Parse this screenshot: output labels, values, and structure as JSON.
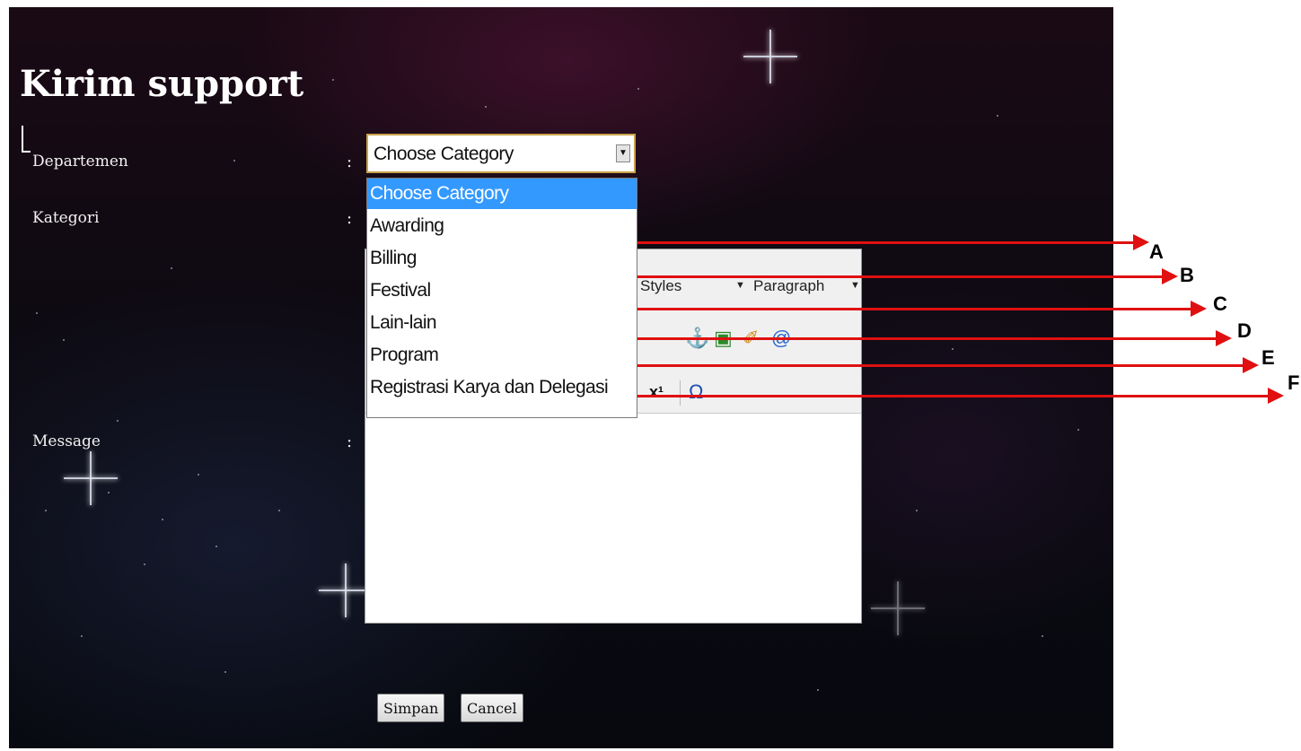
{
  "page": {
    "title": "Kirim support"
  },
  "form": {
    "departemen_label": "Departemen",
    "kategori_label": "Kategori",
    "message_label": "Message",
    "colon": ":"
  },
  "category_select": {
    "selected_value": "Choose Category",
    "options": [
      "Choose Category",
      "Awarding",
      "Billing",
      "Festival",
      "Lain-lain",
      "Program",
      "Registrasi Karya dan Delegasi"
    ]
  },
  "editor": {
    "styles_label": "Styles",
    "paragraph_label": "Paragraph",
    "superscript_label": "x¹",
    "omega_label": "Ω"
  },
  "buttons": {
    "save_label": "Simpan",
    "cancel_label": "Cancel"
  },
  "annotations": {
    "letters": [
      "A",
      "B",
      "C",
      "D",
      "E",
      "F"
    ],
    "arrow_color": "#e01010"
  },
  "colors": {
    "selected_option_bg": "#3399ff",
    "select_border": "#c8a24a"
  }
}
